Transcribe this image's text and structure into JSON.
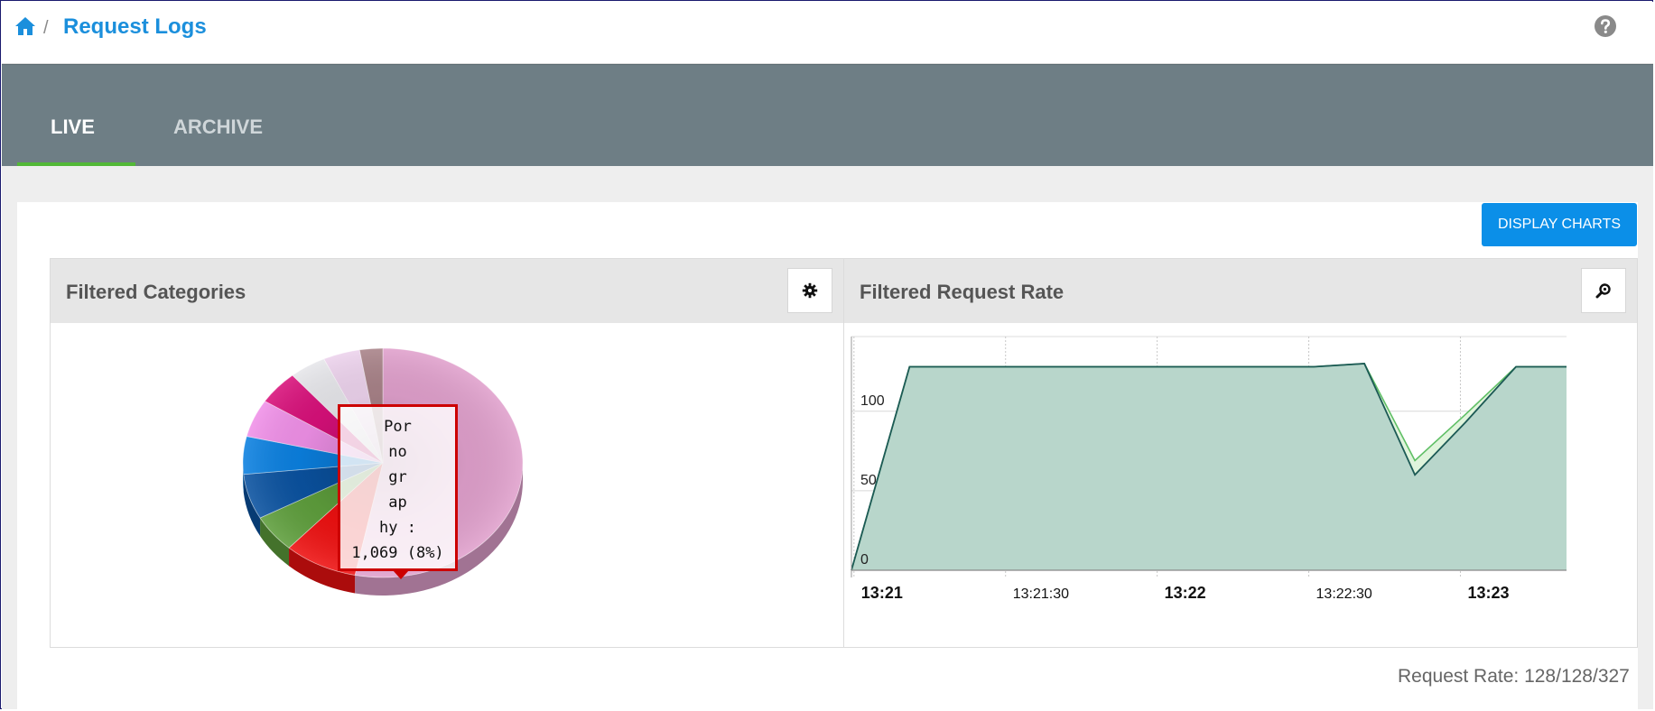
{
  "header": {
    "title": "Request Logs",
    "separator": "/"
  },
  "tabs": [
    {
      "label": "LIVE",
      "active": true
    },
    {
      "label": "ARCHIVE",
      "active": false
    }
  ],
  "toolbar": {
    "display_charts_label": "DISPLAY CHARTS"
  },
  "panels": {
    "categories": {
      "title": "Filtered Categories",
      "tool_icon": "gear-icon"
    },
    "rate": {
      "title": "Filtered Request Rate",
      "tool_icon": "zoom-icon"
    }
  },
  "tooltip": {
    "lines": [
      "Por",
      "no",
      "gr",
      "ap",
      "hy :"
    ],
    "value": "1,069 (8%)"
  },
  "footer": {
    "request_rate": "Request Rate: 128/128/327"
  },
  "colors": {
    "accent": "#1b8fdc",
    "button": "#0b8fe8",
    "tabbar": "#6e7e85",
    "tab_indicator": "#52b837",
    "area_fill": "#b8d6cb",
    "line_dark": "#1c5a55",
    "line_light": "#5fbf65"
  },
  "chart_data": [
    {
      "type": "pie",
      "title": "",
      "slices": [
        {
          "value": 0.5,
          "color": "#e0a0cc"
        },
        {
          "value": 0.08,
          "color": "#ee1111"
        },
        {
          "value": 0.05,
          "color": "#5e9e3c"
        },
        {
          "value": 0.06,
          "color": "#0a52a0"
        },
        {
          "value": 0.05,
          "color": "#0b80e0"
        },
        {
          "value": 0.05,
          "color": "#f090e8"
        },
        {
          "value": 0.045,
          "color": "#d8107a"
        },
        {
          "value": 0.04,
          "color": "#e6e6ea"
        },
        {
          "value": 0.04,
          "color": "#ecd2ec"
        },
        {
          "value": 0.025,
          "color": "#a88288"
        }
      ]
    },
    {
      "type": "area",
      "title": "",
      "ytick_labels": [
        "0",
        "50",
        "100"
      ],
      "yticks": [
        0,
        50,
        100
      ],
      "ylim": [
        0,
        147
      ],
      "xtick_labels": [
        "13:21",
        "13:21:30",
        "13:22",
        "13:22:30",
        "13:23"
      ],
      "xticks_seconds": [
        0,
        30,
        60,
        90,
        120
      ],
      "xlim_seconds": [
        -0.5,
        141
      ],
      "bold_xticks": [
        "13:21",
        "13:22",
        "13:23"
      ],
      "series": [
        {
          "values_x_seconds": [
            -0.5,
            11,
            21,
            31,
            41,
            51,
            61,
            71,
            81,
            91,
            101,
            111,
            121,
            131,
            141
          ],
          "values_y": [
            0,
            128,
            128,
            128,
            128,
            128,
            128,
            128,
            128,
            128,
            130,
            60,
            93,
            128,
            128
          ]
        },
        {
          "values_x_seconds": [
            -0.5,
            11,
            21,
            31,
            41,
            51,
            61,
            71,
            81,
            91,
            101,
            111,
            121,
            131,
            141
          ],
          "values_y": [
            0,
            128,
            128,
            128,
            128,
            128,
            128,
            128,
            128,
            128,
            130,
            69,
            98,
            128,
            128
          ]
        }
      ]
    }
  ]
}
